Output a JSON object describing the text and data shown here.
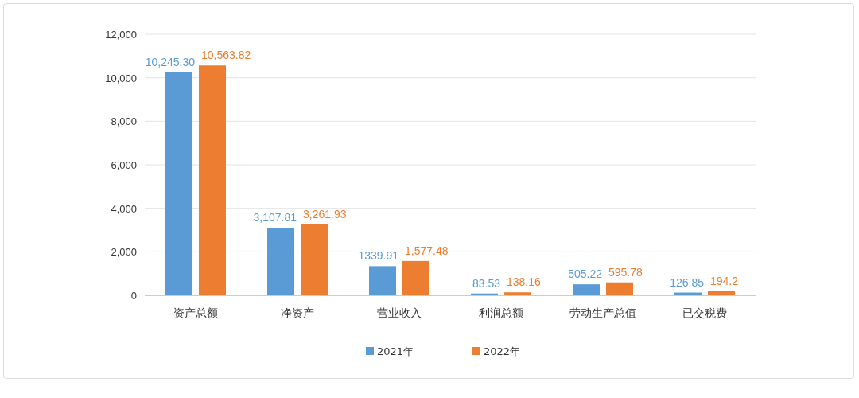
{
  "chart_data": {
    "type": "bar",
    "categories": [
      "资产总额",
      "净资产",
      "营业收入",
      "利润总额",
      "劳动生产总值",
      "已交税费"
    ],
    "series": [
      {
        "name": "2021年",
        "color": "#5b9bd5",
        "values": [
          10245.3,
          3107.81,
          1339.91,
          83.53,
          505.22,
          126.85
        ]
      },
      {
        "name": "2022年",
        "color": "#ed7d31",
        "values": [
          10563.82,
          3261.93,
          1577.48,
          138.16,
          595.78,
          194.2
        ]
      }
    ],
    "value_labels": [
      [
        "10,245.30",
        "3,107.81",
        "1339.91",
        "83.53",
        "505.22",
        "126.85"
      ],
      [
        "10,563.82",
        "3,261.93",
        "1,577.48",
        "138.16",
        "595.78",
        "194.2"
      ]
    ],
    "ylim": [
      0,
      12000
    ],
    "grid": true,
    "legend": true,
    "yticks": [
      {
        "value": 0,
        "label": "0"
      },
      {
        "value": 2000,
        "label": "2,000"
      },
      {
        "value": 4000,
        "label": "4,000"
      },
      {
        "value": 6000,
        "label": "6,000"
      },
      {
        "value": 8000,
        "label": "8,000"
      },
      {
        "value": 10000,
        "label": "10,000"
      },
      {
        "value": 12000,
        "label": "12,000"
      }
    ]
  }
}
